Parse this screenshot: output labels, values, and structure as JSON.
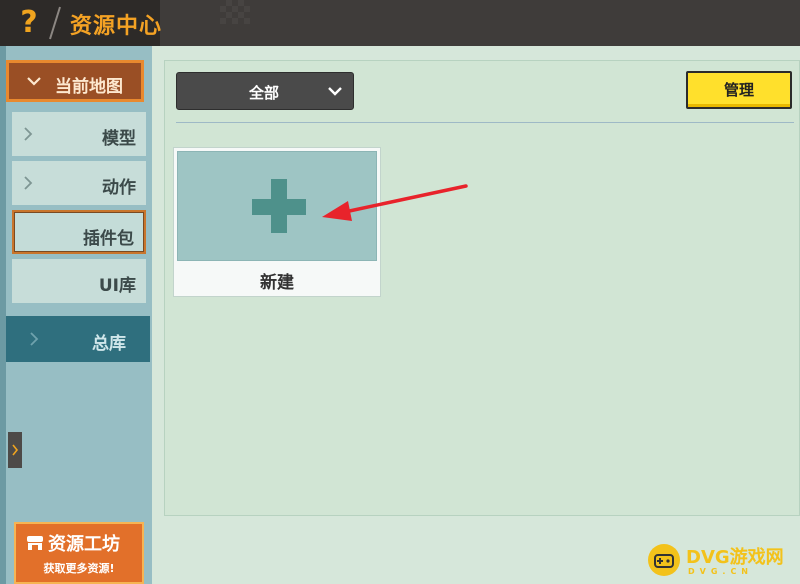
{
  "header": {
    "title": "资源中心",
    "help_icon": "help-icon"
  },
  "sidebar": {
    "current_map": "当前地图",
    "items": [
      {
        "label": "模型"
      },
      {
        "label": "动作"
      },
      {
        "label": "插件包"
      },
      {
        "label": "UI库"
      }
    ],
    "total": "总库",
    "workshop": {
      "title": "资源工坊",
      "subtitle": "获取更多资源!"
    }
  },
  "main": {
    "filter": {
      "selected": "全部"
    },
    "manage_label": "管理",
    "new_card_label": "新建"
  },
  "watermark": {
    "text": "DVG游戏网",
    "sub": "DVG.CN"
  },
  "colors": {
    "accent_orange": "#e9892e",
    "manage_yellow": "#ffe02c",
    "arrow_red": "#e8232b"
  }
}
